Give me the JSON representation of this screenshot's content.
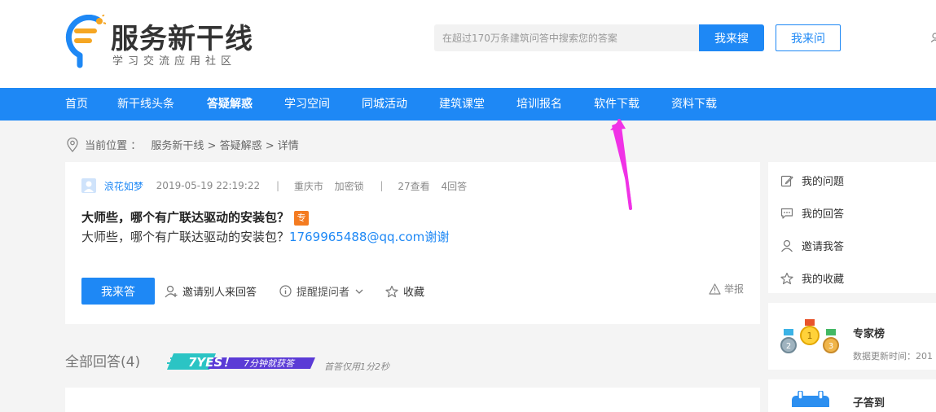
{
  "brand": {
    "title": "服务新干线",
    "subtitle": "学习交流应用社区"
  },
  "search": {
    "placeholder": "在超过170万条建筑问答中搜索您的答案",
    "button_label": "我来搜",
    "ask_label": "我来问"
  },
  "nav": {
    "items": [
      "首页",
      "新干线头条",
      "答疑解惑",
      "学习空间",
      "同城活动",
      "建筑课堂",
      "培训报名",
      "软件下载",
      "资料下载"
    ],
    "active_index": 2
  },
  "breadcrumb": {
    "prefix": "当前位置 ：",
    "path": "服务新干线 > 答疑解惑 > 详情"
  },
  "question": {
    "user": "浪花如梦",
    "datetime": "2019-05-19 22:19:22",
    "sep1": "|",
    "city": "重庆市",
    "software": "加密锁",
    "sep2": "|",
    "views": "27查看",
    "answers": "4回答",
    "title": "大师些，哪个有广联达驱动的安装包？",
    "tag": "专",
    "body_text": "大师些，哪个有广联达驱动的安装包？",
    "body_link": "1769965488@qq.com",
    "body_suffix": "谢谢",
    "answer_button": "我来答",
    "invite_label": "邀请别人来回答",
    "remind_label": "提醒提问者",
    "collect_label": "收藏",
    "report_label": "举报"
  },
  "answers_section": {
    "heading": "全部回答(4)",
    "badge_big": "7YES！",
    "badge_text": "7分钟就获答",
    "note": "首答仅用1分2秒"
  },
  "sidebar": {
    "items": [
      "我的问题",
      "我的回答",
      "邀请我答",
      "我的收藏"
    ],
    "expert_title": "专家榜",
    "expert_update": "数据更新时间：201",
    "next_title": "子答到"
  },
  "colors": {
    "brand_blue": "#1e88f5",
    "page_bg": "#f4f4f4",
    "tag_orange": "#f47b20",
    "annotation_magenta": "#f032e6"
  }
}
